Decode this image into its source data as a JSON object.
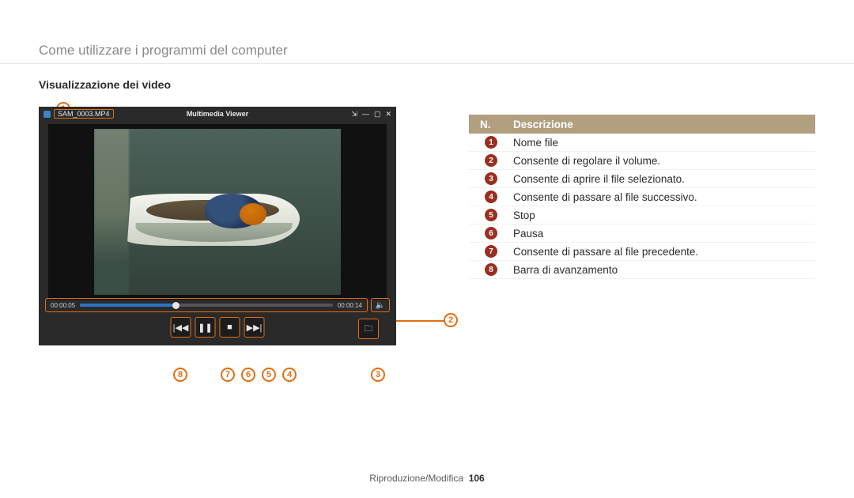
{
  "chapter_title": "Come utilizzare i programmi del computer",
  "section_heading": "Visualizzazione dei video",
  "player": {
    "filename": "SAM_0003.MP4",
    "app_title": "Multimedia Viewer",
    "win_icons": {
      "arrows": "⇲",
      "min": "—",
      "max": "▢",
      "close": "✕"
    },
    "time_current": "00:00:05",
    "time_total": "00:00:14",
    "volume_glyph": "🔈",
    "buttons": {
      "prev": "|◀◀",
      "pause": "❚❚",
      "stop": "■",
      "next": "▶▶|",
      "folder": "🗀"
    }
  },
  "callouts": {
    "c1": "1",
    "c2": "2",
    "c3": "3",
    "c4": "4",
    "c5": "5",
    "c6": "6",
    "c7": "7",
    "c8": "8"
  },
  "table": {
    "head_n": "N.",
    "head_d": "Descrizione",
    "rows": [
      {
        "n": "1",
        "d": "Nome file"
      },
      {
        "n": "2",
        "d": "Consente di regolare il volume."
      },
      {
        "n": "3",
        "d": "Consente di aprire il file selezionato."
      },
      {
        "n": "4",
        "d": "Consente di passare al file successivo."
      },
      {
        "n": "5",
        "d": "Stop"
      },
      {
        "n": "6",
        "d": "Pausa"
      },
      {
        "n": "7",
        "d": "Consente di passare al file precedente."
      },
      {
        "n": "8",
        "d": "Barra di avanzamento"
      }
    ]
  },
  "footer": {
    "section": "Riproduzione/Modifica",
    "page": "106"
  }
}
